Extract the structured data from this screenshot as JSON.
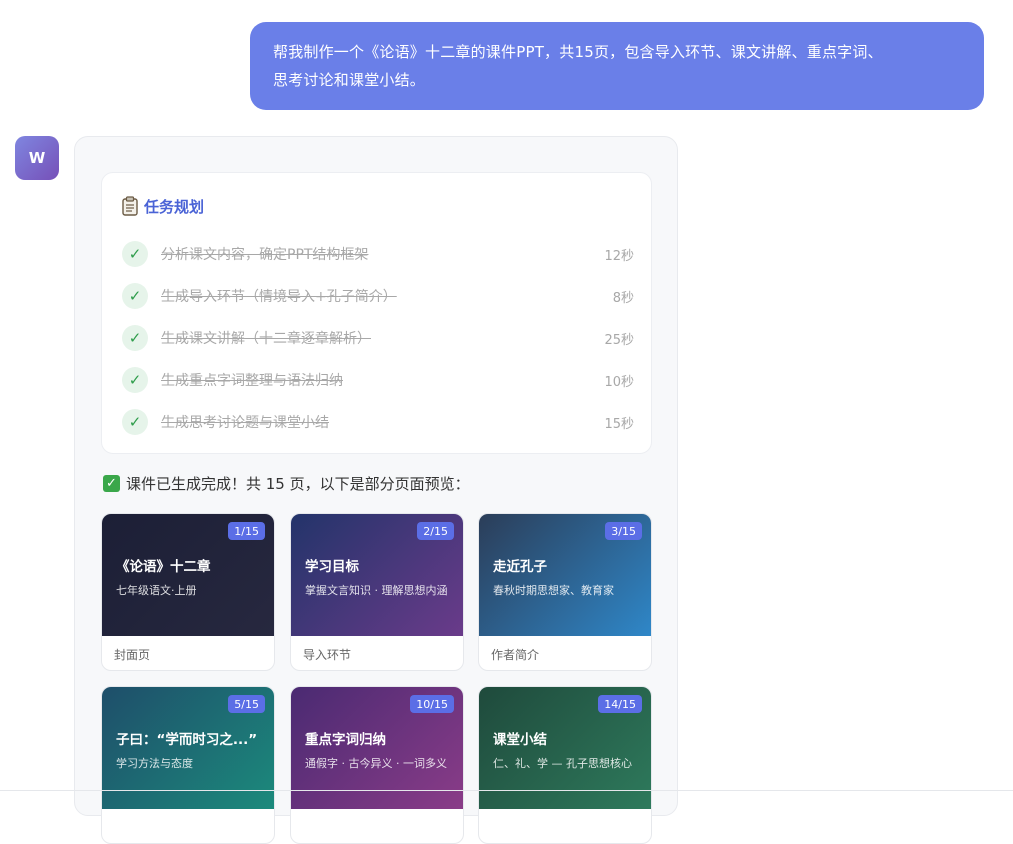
{
  "user_message": {
    "line1": "帮我制作一个《论语》十二章的课件PPT，共15页，包含导入环节、课文讲解、重点字词、",
    "line2": "思考讨论和课堂小结。"
  },
  "assistant": {
    "avatar_letter": "W",
    "plan": {
      "title": "任务规划",
      "tasks": [
        {
          "text": "分析课文内容，确定PPT结构框架",
          "time": "12秒"
        },
        {
          "text": "生成导入环节（情境导入+孔子简介）",
          "time": "8秒"
        },
        {
          "text": "生成课文讲解（十二章逐章解析）",
          "time": "25秒"
        },
        {
          "text": "生成重点字词整理与语法归纳",
          "time": "10秒"
        },
        {
          "text": "生成思考讨论题与课堂小结",
          "time": "15秒"
        }
      ]
    },
    "completion_text": "课件已生成完成！共 15 页，以下是部分页面预览：",
    "slides": [
      {
        "badge": "1/15",
        "title": "《论语》十二章",
        "subtitle": "七年级语文·上册",
        "label": "封面页",
        "bg_from": "#1c1f36",
        "bg_to": "#27283f"
      },
      {
        "badge": "2/15",
        "title": "学习目标",
        "subtitle": "掌握文言知识 · 理解思想内涵",
        "label": "导入环节",
        "bg_from": "#23346a",
        "bg_to": "#6a3b8a"
      },
      {
        "badge": "3/15",
        "title": "走近孔子",
        "subtitle": "春秋时期思想家、教育家",
        "label": "作者简介",
        "bg_from": "#2b3d58",
        "bg_to": "#2f87c8"
      },
      {
        "badge": "5/15",
        "title": "子曰：“学而时习之...”",
        "subtitle": "学习方法与态度",
        "label": "",
        "bg_from": "#1e4e6a",
        "bg_to": "#1c8a7c"
      },
      {
        "badge": "10/15",
        "title": "重点字词归纳",
        "subtitle": "通假字 · 古今异义 · 一词多义",
        "label": "",
        "bg_from": "#4a2a72",
        "bg_to": "#8a3c88"
      },
      {
        "badge": "14/15",
        "title": "课堂小结",
        "subtitle": "仁、礼、学 — 孔子思想核心",
        "label": "",
        "bg_from": "#1f4a3c",
        "bg_to": "#2e7a5c"
      }
    ]
  },
  "icons": {
    "plan_icon": "clipboard-icon",
    "task_check": "check-icon",
    "done_check": "checkbox-checked-icon"
  },
  "colors": {
    "user_bubble": "#6a7fe8",
    "accent_title": "#4a63d6",
    "badge": "#5b6ee6",
    "check_green": "#2e9d4b"
  }
}
